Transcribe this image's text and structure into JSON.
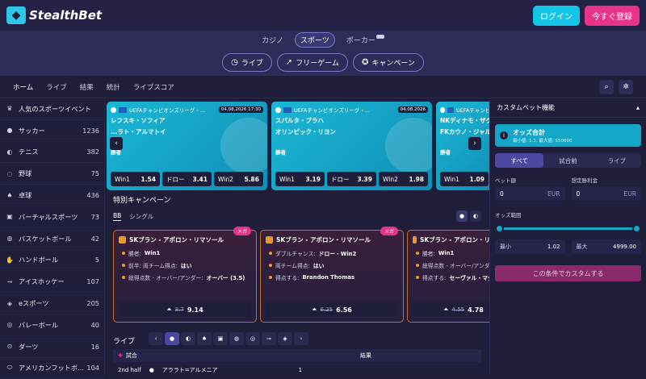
{
  "header": {
    "brand": "StealthBet",
    "login_label": "ログイン",
    "register_label": "今すぐ登録"
  },
  "categories": [
    {
      "label": "カジノ",
      "active": false
    },
    {
      "label": "スポーツ",
      "active": true
    },
    {
      "label": "ポーカー",
      "active": false
    }
  ],
  "features": [
    {
      "icon": "stopwatch-icon",
      "label": "ライブ"
    },
    {
      "icon": "rocket-icon",
      "label": "フリーゲーム"
    },
    {
      "icon": "gift-icon",
      "label": "キャンペーン"
    }
  ],
  "nav": [
    "ホーム",
    "ライブ",
    "結果",
    "統計",
    "ライブスコア"
  ],
  "sidebar": [
    {
      "icon": "trophy-icon",
      "label": "人気のスポーツイベント",
      "count": ""
    },
    {
      "icon": "soccer-icon",
      "label": "サッカー",
      "count": "1236"
    },
    {
      "icon": "tennis-icon",
      "label": "テニス",
      "count": "382"
    },
    {
      "icon": "baseball-icon",
      "label": "野球",
      "count": "75"
    },
    {
      "icon": "table-tennis-icon",
      "label": "卓球",
      "count": "436"
    },
    {
      "icon": "virtual-sports-icon",
      "label": "バーチャルスポーツ",
      "count": "73"
    },
    {
      "icon": "basketball-icon",
      "label": "バスケットボール",
      "count": "42"
    },
    {
      "icon": "handball-icon",
      "label": "ハンドボール",
      "count": "5"
    },
    {
      "icon": "ice-hockey-icon",
      "label": "アイスホッケー",
      "count": "107"
    },
    {
      "icon": "esports-icon",
      "label": "eスポーツ",
      "count": "205"
    },
    {
      "icon": "volleyball-icon",
      "label": "バレーボール",
      "count": "40"
    },
    {
      "icon": "darts-icon",
      "label": "ダーツ",
      "count": "16"
    },
    {
      "icon": "american-football-icon",
      "label": "アメリカンフットボ...",
      "count": "104"
    }
  ],
  "matches": [
    {
      "league": "UEFAチャンピオンズリーグ・...",
      "date": "04.08.2026 17:30",
      "team1": "レフスキ・ソフィア",
      "team2": "...ラト・アルマトイ",
      "winner_label": "勝者",
      "odds": [
        {
          "label": "Win1",
          "value": "1.54"
        },
        {
          "label": "ドロー",
          "value": "3.41"
        },
        {
          "label": "Win2",
          "value": "5.86"
        }
      ]
    },
    {
      "league": "UEFAチャンピオンズリーグ・...",
      "date": "04.08.2026",
      "team1": "スパルタ・プラハ",
      "team2": "オリンピック・リヨン",
      "winner_label": "勝者",
      "odds": [
        {
          "label": "Win1",
          "value": "3.19"
        },
        {
          "label": "ドロー",
          "value": "3.39"
        },
        {
          "label": "Win2",
          "value": "1.98"
        }
      ]
    },
    {
      "league": "UEFAチャンピオ",
      "date": "",
      "team1": "NKディナモ・ザグ",
      "team2": "FKカウノ・ジャル",
      "winner_label": "勝者",
      "odds": [
        {
          "label": "Win1",
          "value": "1.09"
        }
      ]
    }
  ],
  "special": {
    "title": "特別キャンペーン",
    "tabs": [
      "BB",
      "シングル"
    ]
  },
  "bets": [
    {
      "badge": "メガ",
      "title": "SKブラン - アポロン・リマソール",
      "lines": [
        {
          "k": "勝者:",
          "v": "Win1"
        },
        {
          "k": "前半: 両チーム得点:",
          "v": "はい"
        },
        {
          "k": "総得点数 - オーバー/アンダー:",
          "v": "オーバー (3.5)"
        }
      ],
      "old": "8.7",
      "new": "9.14"
    },
    {
      "badge": "メガ",
      "title": "SKブラン - アポロン・リマソール",
      "lines": [
        {
          "k": "ダブルチャンス:",
          "v": "ドロー・Win2"
        },
        {
          "k": "両チーム得点:",
          "v": "はい"
        },
        {
          "k": "得点する:",
          "v": "Brandon Thomas"
        }
      ],
      "old": "6.25",
      "new": "6.56"
    },
    {
      "badge": "",
      "title": "SKブラン - アポロン・リマソール",
      "lines": [
        {
          "k": "勝者:",
          "v": "Win1"
        },
        {
          "k": "総得点数 - オーバー/アンダー:",
          "v": ""
        },
        {
          "k": "得点する:",
          "v": "セーヴァル・マグヌソ..."
        }
      ],
      "old": "4.55",
      "new": "4.78"
    }
  ],
  "live": {
    "title": "ライブ",
    "head_match": "試合",
    "head_result": "結果",
    "row_period": "2nd half",
    "row_team": "アララト=アルメニア",
    "row_score": "1"
  },
  "right_panel": {
    "title": "カスタムベット機能",
    "odds_total_title": "オッズ合計",
    "odds_total_sub": "最小値: 1.1, 最大値: 550000",
    "tabs": [
      "すべて",
      "試合前",
      "ライブ"
    ],
    "stake_label": "ベット額",
    "stake_value": "0",
    "payout_label": "想定勝利金",
    "payout_value": "0",
    "currency": "EUR",
    "range_label": "オッズ範囲",
    "min_label": "最小",
    "min_value": "1.02",
    "max_label": "最大",
    "max_value": "4999.00",
    "cta": "この条件でカスタムする"
  }
}
